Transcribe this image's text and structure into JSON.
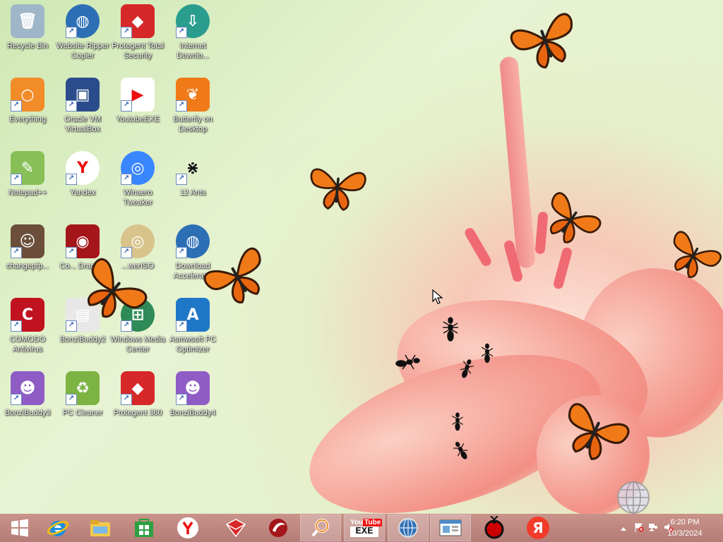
{
  "desktop_icons": [
    {
      "name": "recycle-bin",
      "label": "Recycle Bin",
      "icon": "recycle-bin-icon"
    },
    {
      "name": "website-ripper-copier",
      "label": "Website Ripper Copier",
      "icon": "globe-icon"
    },
    {
      "name": "protegent-total-security",
      "label": "Protegent Total Security",
      "icon": "shield-icon"
    },
    {
      "name": "internet-download",
      "label": "Internet Downlo...",
      "icon": "download-globe-icon"
    },
    {
      "name": "everything",
      "label": "Everything",
      "icon": "magnifier-icon"
    },
    {
      "name": "oracle-vm-virtualbox",
      "label": "Oracle VM VirtualBox",
      "icon": "cube-icon"
    },
    {
      "name": "youtubeexe",
      "label": "YoutubeEXE",
      "icon": "youtube-icon"
    },
    {
      "name": "butterfly-on-desktop",
      "label": "Butterfly on Desktop",
      "icon": "butterfly-icon"
    },
    {
      "name": "notepad-plus-plus",
      "label": "Notepad++",
      "icon": "notepad-icon"
    },
    {
      "name": "yandex",
      "label": "Yandex",
      "icon": "yandex-icon"
    },
    {
      "name": "winaero-tweaker",
      "label": "Winaero Tweaker",
      "icon": "swirl-icon"
    },
    {
      "name": "12-ants",
      "label": "12 Ants",
      "icon": "ant-icon"
    },
    {
      "name": "changepfp",
      "label": "changepfp...",
      "icon": "person-icon"
    },
    {
      "name": "comodo-dragon",
      "label": "Co... Drago...",
      "icon": "dragon-icon"
    },
    {
      "name": "poweriso",
      "label": "...werISO",
      "icon": "disc-icon"
    },
    {
      "name": "download-accelerator",
      "label": "Download Accelerat...",
      "icon": "globe-icon"
    },
    {
      "name": "comodo-antivirus",
      "label": "COMODO Antivirus",
      "icon": "comodo-icon"
    },
    {
      "name": "bonzibuddy2",
      "label": "BonziBuddy2",
      "icon": "file-icon"
    },
    {
      "name": "windows-media-center",
      "label": "Windows Media Center",
      "icon": "windows-orb-icon"
    },
    {
      "name": "asmwsoft-pc-optimizer",
      "label": "Asmwsoft PC Optimizer",
      "icon": "a-icon"
    },
    {
      "name": "bonzibuddy3",
      "label": "BonziBuddy3",
      "icon": "purple-gorilla-icon"
    },
    {
      "name": "pc-cleaner",
      "label": "PC Cleaner",
      "icon": "recycle-icon"
    },
    {
      "name": "protegent-360",
      "label": "Protegent 360",
      "icon": "shield-icon"
    },
    {
      "name": "bonzibuddy4",
      "label": "BonziBuddy4",
      "icon": "purple-gorilla-icon"
    }
  ],
  "taskbar": {
    "items": [
      {
        "name": "start",
        "icon": "windows-logo-icon"
      },
      {
        "name": "internet-explorer",
        "icon": "ie-icon"
      },
      {
        "name": "file-explorer",
        "icon": "folder-icon"
      },
      {
        "name": "store",
        "icon": "store-icon"
      },
      {
        "name": "yandex",
        "icon": "yandex-icon"
      },
      {
        "name": "protegent",
        "icon": "shield-icon"
      },
      {
        "name": "comodo-dragon",
        "icon": "dragon-icon"
      },
      {
        "name": "everything",
        "icon": "magnifier-icon"
      },
      {
        "name": "youtubeexe",
        "icon": "youtube-icon"
      },
      {
        "name": "website-ripper",
        "icon": "globe-icon"
      },
      {
        "name": "window",
        "icon": "window-icon"
      },
      {
        "name": "ants",
        "icon": "ant-icon"
      },
      {
        "name": "yandex-browser",
        "icon": "yandex-icon"
      }
    ],
    "youtube_top": "You",
    "youtube_bottom": "EXE",
    "yandex_letter": "Я",
    "clock": {
      "time": "6:20 PM",
      "date": "10/3/2024"
    }
  }
}
